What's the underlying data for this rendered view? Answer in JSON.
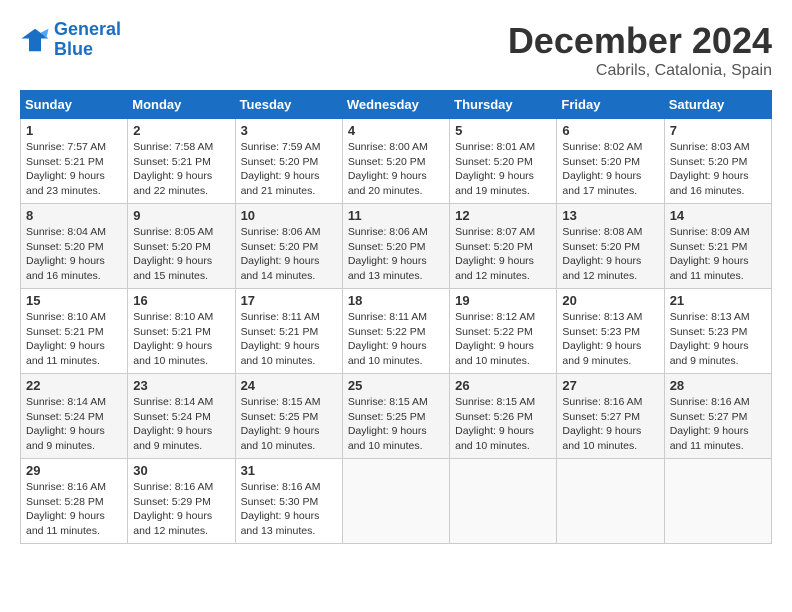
{
  "logo": {
    "line1": "General",
    "line2": "Blue"
  },
  "title": "December 2024",
  "subtitle": "Cabrils, Catalonia, Spain",
  "headers": [
    "Sunday",
    "Monday",
    "Tuesday",
    "Wednesday",
    "Thursday",
    "Friday",
    "Saturday"
  ],
  "weeks": [
    [
      {
        "day": "1",
        "sunrise": "7:57 AM",
        "sunset": "5:21 PM",
        "daylight": "9 hours and 23 minutes."
      },
      {
        "day": "2",
        "sunrise": "7:58 AM",
        "sunset": "5:21 PM",
        "daylight": "9 hours and 22 minutes."
      },
      {
        "day": "3",
        "sunrise": "7:59 AM",
        "sunset": "5:20 PM",
        "daylight": "9 hours and 21 minutes."
      },
      {
        "day": "4",
        "sunrise": "8:00 AM",
        "sunset": "5:20 PM",
        "daylight": "9 hours and 20 minutes."
      },
      {
        "day": "5",
        "sunrise": "8:01 AM",
        "sunset": "5:20 PM",
        "daylight": "9 hours and 19 minutes."
      },
      {
        "day": "6",
        "sunrise": "8:02 AM",
        "sunset": "5:20 PM",
        "daylight": "9 hours and 17 minutes."
      },
      {
        "day": "7",
        "sunrise": "8:03 AM",
        "sunset": "5:20 PM",
        "daylight": "9 hours and 16 minutes."
      }
    ],
    [
      {
        "day": "8",
        "sunrise": "8:04 AM",
        "sunset": "5:20 PM",
        "daylight": "9 hours and 16 minutes."
      },
      {
        "day": "9",
        "sunrise": "8:05 AM",
        "sunset": "5:20 PM",
        "daylight": "9 hours and 15 minutes."
      },
      {
        "day": "10",
        "sunrise": "8:06 AM",
        "sunset": "5:20 PM",
        "daylight": "9 hours and 14 minutes."
      },
      {
        "day": "11",
        "sunrise": "8:06 AM",
        "sunset": "5:20 PM",
        "daylight": "9 hours and 13 minutes."
      },
      {
        "day": "12",
        "sunrise": "8:07 AM",
        "sunset": "5:20 PM",
        "daylight": "9 hours and 12 minutes."
      },
      {
        "day": "13",
        "sunrise": "8:08 AM",
        "sunset": "5:20 PM",
        "daylight": "9 hours and 12 minutes."
      },
      {
        "day": "14",
        "sunrise": "8:09 AM",
        "sunset": "5:21 PM",
        "daylight": "9 hours and 11 minutes."
      }
    ],
    [
      {
        "day": "15",
        "sunrise": "8:10 AM",
        "sunset": "5:21 PM",
        "daylight": "9 hours and 11 minutes."
      },
      {
        "day": "16",
        "sunrise": "8:10 AM",
        "sunset": "5:21 PM",
        "daylight": "9 hours and 10 minutes."
      },
      {
        "day": "17",
        "sunrise": "8:11 AM",
        "sunset": "5:21 PM",
        "daylight": "9 hours and 10 minutes."
      },
      {
        "day": "18",
        "sunrise": "8:11 AM",
        "sunset": "5:22 PM",
        "daylight": "9 hours and 10 minutes."
      },
      {
        "day": "19",
        "sunrise": "8:12 AM",
        "sunset": "5:22 PM",
        "daylight": "9 hours and 10 minutes."
      },
      {
        "day": "20",
        "sunrise": "8:13 AM",
        "sunset": "5:23 PM",
        "daylight": "9 hours and 9 minutes."
      },
      {
        "day": "21",
        "sunrise": "8:13 AM",
        "sunset": "5:23 PM",
        "daylight": "9 hours and 9 minutes."
      }
    ],
    [
      {
        "day": "22",
        "sunrise": "8:14 AM",
        "sunset": "5:24 PM",
        "daylight": "9 hours and 9 minutes."
      },
      {
        "day": "23",
        "sunrise": "8:14 AM",
        "sunset": "5:24 PM",
        "daylight": "9 hours and 9 minutes."
      },
      {
        "day": "24",
        "sunrise": "8:15 AM",
        "sunset": "5:25 PM",
        "daylight": "9 hours and 10 minutes."
      },
      {
        "day": "25",
        "sunrise": "8:15 AM",
        "sunset": "5:25 PM",
        "daylight": "9 hours and 10 minutes."
      },
      {
        "day": "26",
        "sunrise": "8:15 AM",
        "sunset": "5:26 PM",
        "daylight": "9 hours and 10 minutes."
      },
      {
        "day": "27",
        "sunrise": "8:16 AM",
        "sunset": "5:27 PM",
        "daylight": "9 hours and 10 minutes."
      },
      {
        "day": "28",
        "sunrise": "8:16 AM",
        "sunset": "5:27 PM",
        "daylight": "9 hours and 11 minutes."
      }
    ],
    [
      {
        "day": "29",
        "sunrise": "8:16 AM",
        "sunset": "5:28 PM",
        "daylight": "9 hours and 11 minutes."
      },
      {
        "day": "30",
        "sunrise": "8:16 AM",
        "sunset": "5:29 PM",
        "daylight": "9 hours and 12 minutes."
      },
      {
        "day": "31",
        "sunrise": "8:16 AM",
        "sunset": "5:30 PM",
        "daylight": "9 hours and 13 minutes."
      },
      null,
      null,
      null,
      null
    ]
  ]
}
